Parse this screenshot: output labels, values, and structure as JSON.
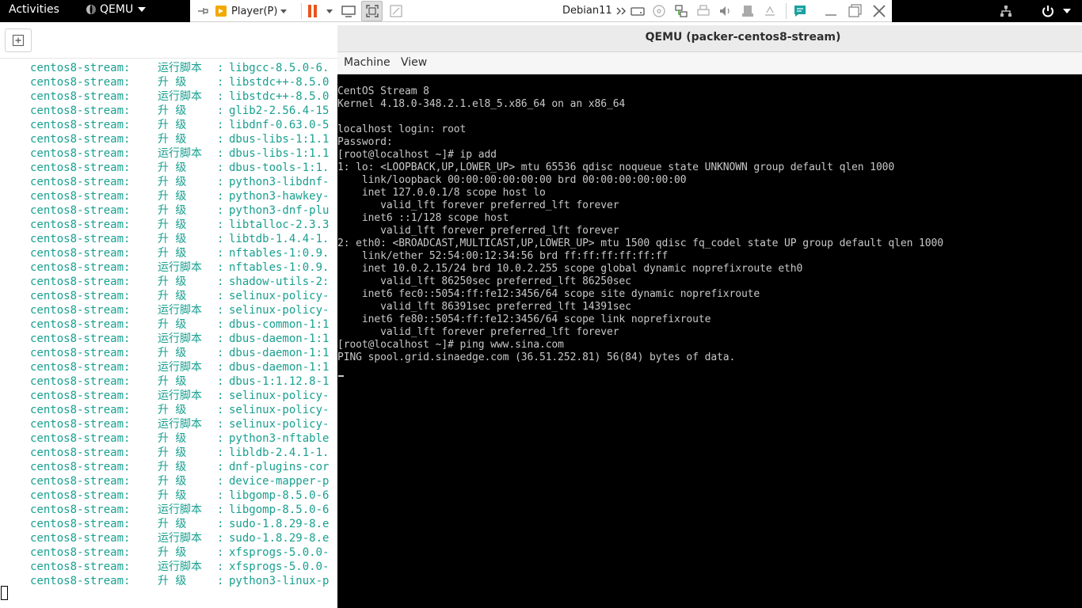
{
  "topbar": {
    "activities": "Activities",
    "app_name": "QEMU"
  },
  "vmware": {
    "player_label": "Player(P)",
    "vm_name": "Debian11"
  },
  "host_log": [
    {
      "prefix": "centos8-stream:",
      "action": "运行脚本",
      "pkg": "libgcc-8.5.0-6."
    },
    {
      "prefix": "centos8-stream:",
      "action": "升 级",
      "pkg": "libstdc++-8.5.0"
    },
    {
      "prefix": "centos8-stream:",
      "action": "运行脚本",
      "pkg": "libstdc++-8.5.0"
    },
    {
      "prefix": "centos8-stream:",
      "action": "升 级",
      "pkg": "glib2-2.56.4-15"
    },
    {
      "prefix": "centos8-stream:",
      "action": "升 级",
      "pkg": "libdnf-0.63.0-5"
    },
    {
      "prefix": "centos8-stream:",
      "action": "升 级",
      "pkg": "dbus-libs-1:1.1"
    },
    {
      "prefix": "centos8-stream:",
      "action": "运行脚本",
      "pkg": "dbus-libs-1:1.1"
    },
    {
      "prefix": "centos8-stream:",
      "action": "升 级",
      "pkg": "dbus-tools-1:1."
    },
    {
      "prefix": "centos8-stream:",
      "action": "升 级",
      "pkg": "python3-libdnf-"
    },
    {
      "prefix": "centos8-stream:",
      "action": "升 级",
      "pkg": "python3-hawkey-"
    },
    {
      "prefix": "centos8-stream:",
      "action": "升 级",
      "pkg": "python3-dnf-plu"
    },
    {
      "prefix": "centos8-stream:",
      "action": "升 级",
      "pkg": "libtalloc-2.3.3"
    },
    {
      "prefix": "centos8-stream:",
      "action": "升 级",
      "pkg": "libtdb-1.4.4-1."
    },
    {
      "prefix": "centos8-stream:",
      "action": "升 级",
      "pkg": "nftables-1:0.9."
    },
    {
      "prefix": "centos8-stream:",
      "action": "运行脚本",
      "pkg": "nftables-1:0.9."
    },
    {
      "prefix": "centos8-stream:",
      "action": "升 级",
      "pkg": "shadow-utils-2:"
    },
    {
      "prefix": "centos8-stream:",
      "action": "升 级",
      "pkg": "selinux-policy-"
    },
    {
      "prefix": "centos8-stream:",
      "action": "运行脚本",
      "pkg": "selinux-policy-"
    },
    {
      "prefix": "centos8-stream:",
      "action": "升 级",
      "pkg": "dbus-common-1:1"
    },
    {
      "prefix": "centos8-stream:",
      "action": "运行脚本",
      "pkg": "dbus-daemon-1:1"
    },
    {
      "prefix": "centos8-stream:",
      "action": "升 级",
      "pkg": "dbus-daemon-1:1"
    },
    {
      "prefix": "centos8-stream:",
      "action": "运行脚本",
      "pkg": "dbus-daemon-1:1"
    },
    {
      "prefix": "centos8-stream:",
      "action": "升 级",
      "pkg": "dbus-1:1.12.8-1"
    },
    {
      "prefix": "centos8-stream:",
      "action": "运行脚本",
      "pkg": "selinux-policy-"
    },
    {
      "prefix": "centos8-stream:",
      "action": "升 级",
      "pkg": "selinux-policy-"
    },
    {
      "prefix": "centos8-stream:",
      "action": "运行脚本",
      "pkg": "selinux-policy-"
    },
    {
      "prefix": "centos8-stream:",
      "action": "升 级",
      "pkg": "python3-nftable"
    },
    {
      "prefix": "centos8-stream:",
      "action": "升 级",
      "pkg": "libldb-2.4.1-1."
    },
    {
      "prefix": "centos8-stream:",
      "action": "升 级",
      "pkg": "dnf-plugins-cor"
    },
    {
      "prefix": "centos8-stream:",
      "action": "升 级",
      "pkg": "device-mapper-p"
    },
    {
      "prefix": "centos8-stream:",
      "action": "升 级",
      "pkg": "libgomp-8.5.0-6"
    },
    {
      "prefix": "centos8-stream:",
      "action": "运行脚本",
      "pkg": "libgomp-8.5.0-6"
    },
    {
      "prefix": "centos8-stream:",
      "action": "升 级",
      "pkg": "sudo-1.8.29-8.e"
    },
    {
      "prefix": "centos8-stream:",
      "action": "运行脚本",
      "pkg": "sudo-1.8.29-8.e"
    },
    {
      "prefix": "centos8-stream:",
      "action": "升 级",
      "pkg": "xfsprogs-5.0.0-"
    },
    {
      "prefix": "centos8-stream:",
      "action": "运行脚本",
      "pkg": "xfsprogs-5.0.0-"
    },
    {
      "prefix": "centos8-stream:",
      "action": "升 级",
      "pkg": "python3-linux-p"
    }
  ],
  "qemu": {
    "title": "QEMU (packer-centos8-stream)",
    "menu": [
      "Machine",
      "View"
    ],
    "console": [
      "CentOS Stream 8",
      "Kernel 4.18.0-348.2.1.el8_5.x86_64 on an x86_64",
      "",
      "localhost login: root",
      "Password:",
      "[root@localhost ~]# ip add",
      "1: lo: <LOOPBACK,UP,LOWER_UP> mtu 65536 qdisc noqueue state UNKNOWN group default qlen 1000",
      "    link/loopback 00:00:00:00:00:00 brd 00:00:00:00:00:00",
      "    inet 127.0.0.1/8 scope host lo",
      "       valid_lft forever preferred_lft forever",
      "    inet6 ::1/128 scope host",
      "       valid_lft forever preferred_lft forever",
      "2: eth0: <BROADCAST,MULTICAST,UP,LOWER_UP> mtu 1500 qdisc fq_codel state UP group default qlen 1000",
      "    link/ether 52:54:00:12:34:56 brd ff:ff:ff:ff:ff:ff",
      "    inet 10.0.2.15/24 brd 10.0.2.255 scope global dynamic noprefixroute eth0",
      "       valid_lft 86250sec preferred_lft 86250sec",
      "    inet6 fec0::5054:ff:fe12:3456/64 scope site dynamic noprefixroute",
      "       valid_lft 86391sec preferred_lft 14391sec",
      "    inet6 fe80::5054:ff:fe12:3456/64 scope link noprefixroute",
      "       valid_lft forever preferred_lft forever",
      "[root@localhost ~]# ping www.sina.com",
      "PING spool.grid.sinaedge.com (36.51.252.81) 56(84) bytes of data."
    ]
  },
  "colors": {
    "log_text": "#18a090",
    "console_text": "#c8c8c8",
    "vmware_pause": "#e8541c",
    "vmware_player_icon": "#f2a900"
  }
}
